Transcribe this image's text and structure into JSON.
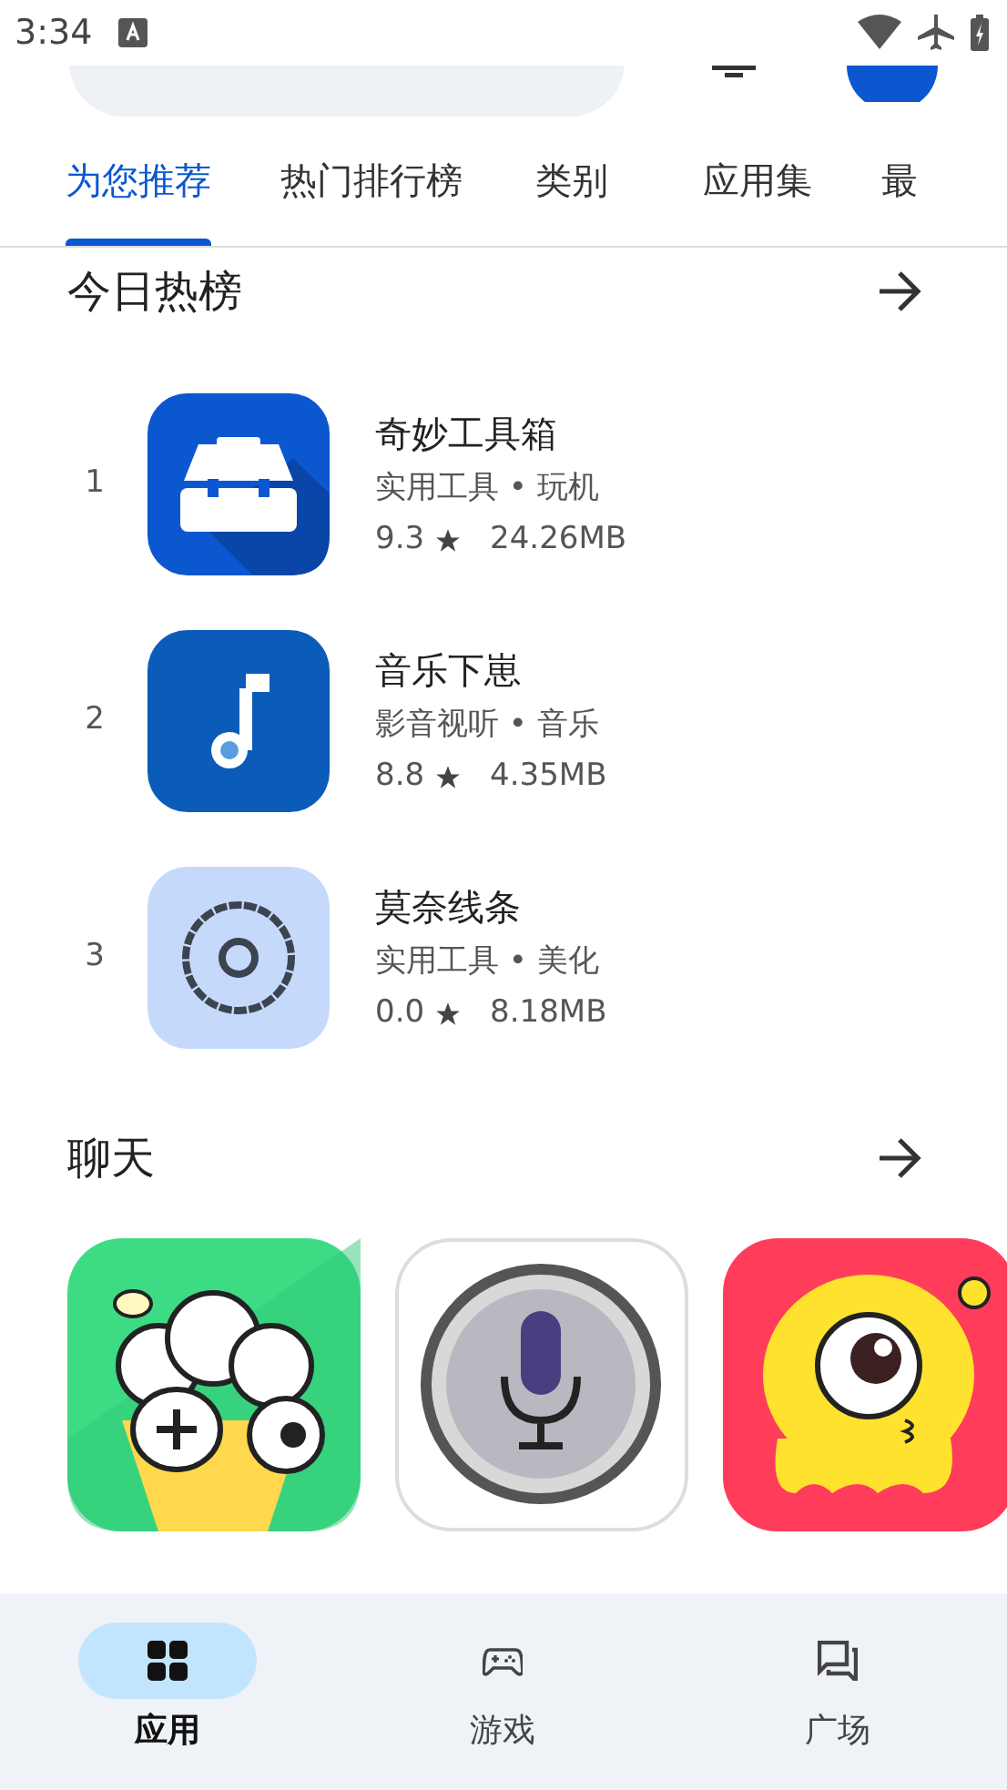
{
  "status_bar": {
    "time": "3:34"
  },
  "tabs": [
    {
      "label": "为您推荐",
      "selected": true
    },
    {
      "label": "热门排行榜",
      "selected": false
    },
    {
      "label": "类别",
      "selected": false
    },
    {
      "label": "应用集",
      "selected": false
    },
    {
      "label": "最",
      "selected": false
    }
  ],
  "ranked_section": {
    "title": "今日热榜",
    "apps": [
      {
        "rank": "1",
        "name": "奇妙工具箱",
        "category": "实用工具 • 玩机",
        "rating": "9.3",
        "size": "24.26MB"
      },
      {
        "rank": "2",
        "name": "音乐下崽",
        "category": "影音视听 • 音乐",
        "rating": "8.8",
        "size": "4.35MB"
      },
      {
        "rank": "3",
        "name": "莫奈线条",
        "category": "实用工具 • 美化",
        "rating": "0.0",
        "size": "8.18MB"
      }
    ]
  },
  "chat_section": {
    "title": "聊天"
  },
  "bottom_nav": [
    {
      "label": "应用",
      "selected": true
    },
    {
      "label": "游戏",
      "selected": false
    },
    {
      "label": "广场",
      "selected": false
    }
  ]
}
